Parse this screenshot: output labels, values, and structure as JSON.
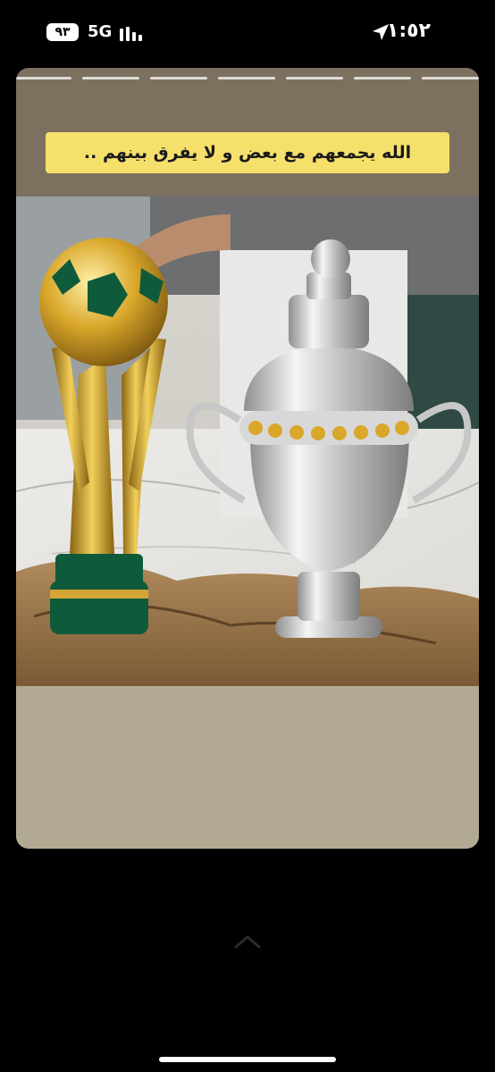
{
  "status_bar": {
    "time": "١:٥٢",
    "battery": "٩٣",
    "network": "5G"
  },
  "story": {
    "caption": "الله يجمعهم مع بعض و لا يفرق بينهم ..",
    "segments": 7
  },
  "colors": {
    "background": "#000000",
    "caption_bg": "#f6e06c",
    "frame_top": "#7c715f",
    "frame_bottom": "#b2a992"
  },
  "icons": [
    "location-arrow-icon",
    "signal-bars-icon",
    "chevron-up-icon"
  ]
}
